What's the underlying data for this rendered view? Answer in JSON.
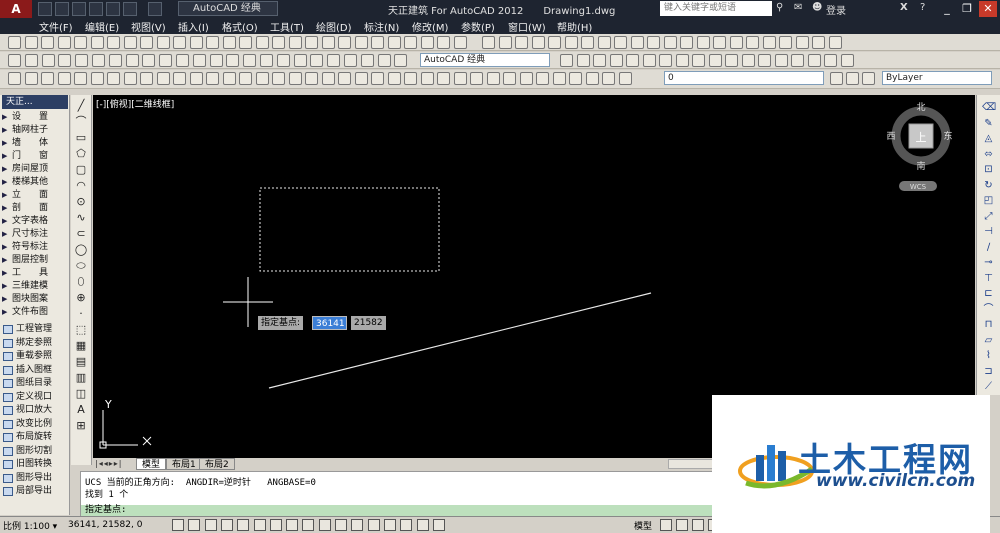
{
  "title": {
    "logo": "A",
    "workspace": "AutoCAD 经典",
    "app_title": "天正建筑 For AutoCAD 2012",
    "document": "Drawing1.dwg",
    "search_placeholder": "键入关键字或短语",
    "login": "登录"
  },
  "menu": [
    "文件(F)",
    "编辑(E)",
    "视图(V)",
    "插入(I)",
    "格式(O)",
    "工具(T)",
    "绘图(D)",
    "标注(N)",
    "修改(M)",
    "参数(P)",
    "窗口(W)",
    "帮助(H)"
  ],
  "toolbar": {
    "workspace_combo": "AutoCAD 经典",
    "layer_value": "0",
    "color_value": "ByLayer"
  },
  "tianzheng": {
    "title": "天正...",
    "items": [
      "设　　置",
      "轴网柱子",
      "墙　　体",
      "门　　窗",
      "房间屋顶",
      "楼梯其他",
      "立　　面",
      "剖　　面",
      "文字表格",
      "尺寸标注",
      "符号标注",
      "图层控制",
      "工　　具",
      "三维建模",
      "图块图案",
      "文件布图"
    ],
    "items2": [
      "工程管理",
      "绑定参照",
      "重载参照",
      "插入图框",
      "图纸目录",
      "定义视口",
      "视口放大",
      "改变比例",
      "布局旋转",
      "图形切割",
      "旧图转换",
      "图形导出",
      "局部导出"
    ]
  },
  "canvas": {
    "viewport_label": "[-][俯视][二维线框]",
    "viewcube": {
      "north": "北",
      "south": "南",
      "east": "东",
      "west": "西",
      "top": "上",
      "wcs": "WCS"
    },
    "ucs": {
      "x": "X",
      "y": "Y"
    },
    "dynamic_input": {
      "prompt": "指定基点:",
      "x": "36141",
      "y": "21582"
    }
  },
  "tabs": [
    "模型",
    "布局1",
    "布局2"
  ],
  "command": {
    "line1": "UCS 当前的正角方向:  ANGDIR=逆时针   ANGBASE=0",
    "line2": "找到 1 个",
    "prompt": "指定基点:"
  },
  "status": {
    "scale": "比例 1:100 ▾",
    "coords": "36141, 21582, 0",
    "model": "模型"
  },
  "watermark": {
    "text": "土木工程网",
    "url": "www.civilcn.com"
  }
}
